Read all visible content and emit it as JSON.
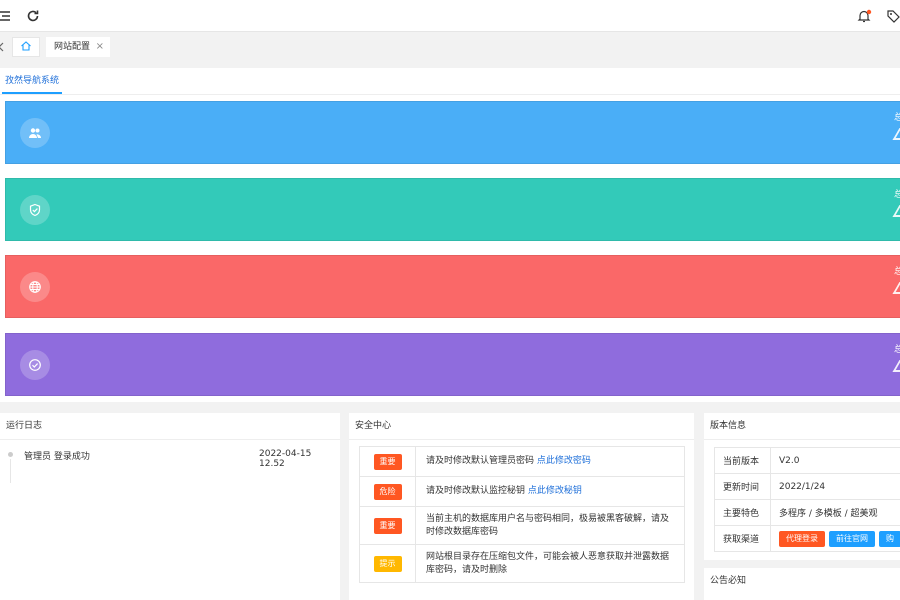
{
  "header": {
    "icons": [
      "menu-icon",
      "refresh-icon",
      "bell-icon",
      "tag-icon"
    ]
  },
  "tabs": {
    "home_icon": "home-icon",
    "items": [
      {
        "label": "网站配置",
        "close": "×"
      }
    ]
  },
  "subtabs": {
    "active_label": "孜然导航系统"
  },
  "stat_cards": [
    {
      "color": "#4aaef7",
      "icon": "users-icon",
      "right_text": "总"
    },
    {
      "color": "#33cab9",
      "icon": "shield-icon",
      "right_text": "总"
    },
    {
      "color": "#fa6868",
      "icon": "globe-icon",
      "right_text": "总"
    },
    {
      "color": "#8f6cdd",
      "icon": "check-circle-icon",
      "right_text": "总"
    }
  ],
  "log_panel": {
    "title": "运行日志",
    "entries": [
      {
        "text": "管理员 登录成功",
        "time": "2022-04-15 12.52"
      }
    ]
  },
  "security_panel": {
    "title": "安全中心",
    "rows": [
      {
        "tag": "重要",
        "tag_color": "#ff5722",
        "text": "请及时修改默认管理员密码",
        "link": "点此修改密码"
      },
      {
        "tag": "危险",
        "tag_color": "#ff5722",
        "text": "请及时修改默认监控秘钥",
        "link": "点此修改秘钥"
      },
      {
        "tag": "重要",
        "tag_color": "#ff5722",
        "text": "当前主机的数据库用户名与密码相同，极易被黑客破解，请及时修改数据库密码",
        "link": ""
      },
      {
        "tag": "提示",
        "tag_color": "#ffb800",
        "text": "网站根目录存在压缩包文件，可能会被人恶意获取并泄露数据库密码，请及时删除",
        "link": ""
      }
    ]
  },
  "version_panel": {
    "title": "版本信息",
    "rows": [
      {
        "key": "当前版本",
        "value": "V2.0"
      },
      {
        "key": "更新时间",
        "value": "2022/1/24"
      },
      {
        "key": "主要特色",
        "value": "多程序 / 多模板 / 超美观"
      }
    ],
    "channel_key": "获取渠道",
    "buttons": [
      "代理登录",
      "前往官网",
      "购"
    ]
  },
  "notice_panel": {
    "title": "公告必知"
  }
}
